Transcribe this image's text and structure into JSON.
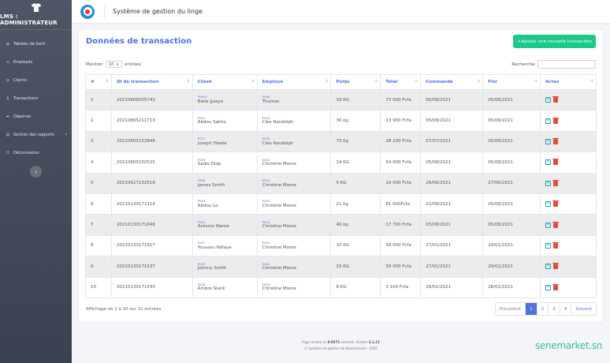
{
  "sidebar": {
    "brand": "LMS : ADMINISTRATEUR",
    "items": [
      {
        "icon": "dashboard-icon",
        "glyph": "◍",
        "label": "Tableau de bord"
      },
      {
        "icon": "users-icon",
        "glyph": "♙",
        "label": "Employés"
      },
      {
        "icon": "clients-icon",
        "glyph": "◎",
        "label": "Clients"
      },
      {
        "icon": "dollar-icon",
        "glyph": "$",
        "label": "Transactions"
      },
      {
        "icon": "share-icon",
        "glyph": "➦",
        "label": "Dépense"
      },
      {
        "icon": "reports-icon",
        "glyph": "▤",
        "label": "Section des rapports",
        "caret": "›"
      },
      {
        "icon": "logout-icon",
        "glyph": "⏻",
        "label": "Déconnexion"
      }
    ],
    "collapse": "‹"
  },
  "topbar": {
    "title": "Système de gestion du linge"
  },
  "card": {
    "title": "Données de transaction",
    "add_button": "+Ajouter une nouvelle transaction",
    "show_prefix": "Montrer",
    "show_value": "10",
    "show_suffix": "entrées",
    "search_label": "Recherche:",
    "info": "Affichage de 1 à 10 sur 31 entrées"
  },
  "table": {
    "headers": [
      "#",
      "ID de transaction",
      "Client",
      "Employé",
      "Poids",
      "Total",
      "Commande",
      "Fini",
      "Actes"
    ],
    "rows": [
      {
        "n": "1",
        "tid": "20210806005743",
        "cid": "P0010",
        "client": "Balla gueye",
        "eid": "E006",
        "emp": "Thomas",
        "poids": "19 KG",
        "total": "73 000 Fcfa",
        "cmd": "05/08/2021",
        "fini": "05/08/2021"
      },
      {
        "n": "2",
        "tid": "20210805211713",
        "cid": "P002",
        "client": "Abdou Sakho",
        "eid": "E005",
        "emp": "Cléa Randolph",
        "poids": "36 kg",
        "total": "13 900 Fcfa",
        "cmd": "05/08/2021",
        "fini": "05/08/2021"
      },
      {
        "n": "3",
        "tid": "20210805153848",
        "cid": "P007",
        "client": "Joseph Howie",
        "eid": "E005",
        "emp": "Cléa Randolph",
        "poids": "73 kg",
        "total": "28 100 Fcfa",
        "cmd": "07/07/2021",
        "fini": "05/08/2021"
      },
      {
        "n": "4",
        "tid": "20210805150525",
        "cid": "P009",
        "client": "Sadio Diop",
        "eid": "E004",
        "emp": "Christine Moore",
        "poids": "14 KG",
        "total": "54 000 Fcfa",
        "cmd": "05/08/2021",
        "fini": "05/08/2021"
      },
      {
        "n": "5",
        "tid": "20210627232518",
        "cid": "P008",
        "client": "James Smith",
        "eid": "E004",
        "emp": "Christine Moore",
        "poids": "5 KG",
        "total": "19 000 Fcfa",
        "cmd": "26/06/2021",
        "fini": "27/06/2021"
      },
      {
        "n": "6",
        "tid": "20210130172114",
        "cid": "P004",
        "client": "Abdou Lo",
        "eid": "E004",
        "emp": "Christine Moore",
        "poids": "21 kg",
        "total": "81 000Fcfa",
        "cmd": "02/08/2021",
        "fini": "05/08/2021"
      },
      {
        "n": "7",
        "tid": "20210130171846",
        "cid": "P005",
        "client": "Antonio Waree",
        "eid": "E004",
        "emp": "Christine Moore",
        "poids": "46 kg",
        "total": "17 700 Fcfa",
        "cmd": "03/08/2021",
        "fini": "05/08/2021"
      },
      {
        "n": "8",
        "tid": "20210130171617",
        "cid": "P007",
        "client": "Youssou Ndiaye",
        "eid": "E004",
        "emp": "Christine Moore",
        "poids": "10 KG",
        "total": "39 000 Fcfa",
        "cmd": "27/01/2021",
        "fini": "29/01/2021"
      },
      {
        "n": "9",
        "tid": "20210130171537",
        "cid": "P003",
        "client": "Johnny Smith",
        "eid": "E004",
        "emp": "Christine Moore",
        "poids": "15 KG",
        "total": "58 000 Fcfa",
        "cmd": "27/01/2021",
        "fini": "29/01/2021"
      },
      {
        "n": "10",
        "tid": "20210130171433",
        "cid": "P006",
        "client": "Ambre Slank",
        "eid": "E004",
        "emp": "Christine Moore",
        "poids": "8 KG",
        "total": "3 100 Fcfa",
        "cmd": "26/01/2021",
        "fini": "28/01/2021"
      }
    ]
  },
  "pagination": {
    "prev": "Précédent",
    "pages": [
      "1",
      "2",
      "3",
      "4"
    ],
    "next": "Suivant",
    "active": "1"
  },
  "footer": {
    "line1_a": "Page rendue en",
    "time": "0.0372",
    "line1_b": "seconde. Version",
    "version": "3.1.11",
    "line2": "© Système de gestion de blanchisserie - 2025"
  },
  "watermark": "senemarket.sn",
  "colors": {
    "accent": "#4e73df",
    "success": "#1cc88a",
    "danger": "#e74a3b",
    "sidebar": "#4e5666"
  }
}
